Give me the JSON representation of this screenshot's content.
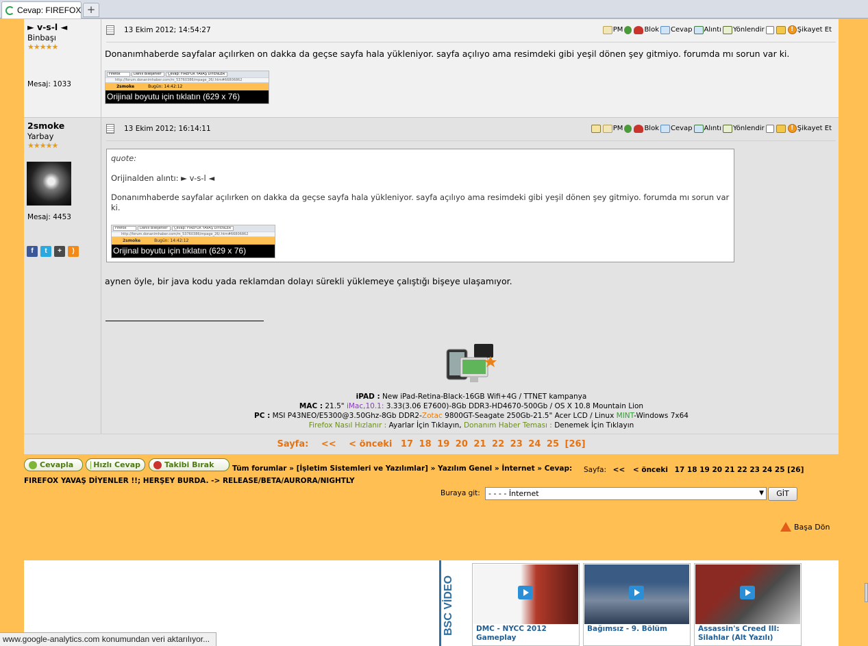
{
  "tab": {
    "title": "Cevap: FIREFOX...",
    "new_tab": "+"
  },
  "posts": [
    {
      "username": "► v-s-l ◄",
      "rank": "Binbaşı",
      "stars": "★★★★★",
      "message_count": "Mesaj: 1033",
      "date": "13 Ekim 2012; 14:54:27",
      "body": "Donanımhaberde sayfalar açılırken on dakka da geçse sayfa hala yükleniyor. sayfa açılıyo ama resimdeki gibi yeşil dönen şey gitmiyo. forumda mı sorun var ki.",
      "thumb_caption": "Orijinal boyutu için tıklatın (629 x 76)"
    },
    {
      "username": "2smoke",
      "rank": "Yarbay",
      "stars": "★★★★★",
      "message_count": "Mesaj: 4453",
      "date": "13 Ekim 2012; 16:14:11",
      "quote_label": "quote:",
      "quote_source": "Orijinalden alıntı: ► v-s-l ◄",
      "quote_body": "Donanımhaberde sayfalar açılırken on dakka da geçse sayfa hala yükleniyor. sayfa açılıyo ama resimdeki gibi yeşil dönen şey gitmiyo. forumda mı sorun var ki.",
      "thumb_caption": "Orijinal boyutu için tıklatın (629 x 76)",
      "body": "aynen öyle, bir java kodu yada reklamdan dolayı sürekli yüklemeye çalıştığı bişeye ulaşamıyor.",
      "signature": {
        "ipad_label": "iPAD :",
        "ipad_text": "New iPad-Retina-Black-16GB Wifi+4G / TTNET kampanya",
        "mac_label": "MAC :",
        "mac_a": "21.5\"",
        "mac_b": "iMac,10.1:",
        "mac_c": "3.33(3.06 E7600)-8Gb DDR3-HD4670-500Gb / OS X 10.8 Mountain Lion",
        "pc_label": "PC :",
        "pc_a": "MSI P43NEO/E5300@3.50Ghz-8Gb DDR2-",
        "pc_b": "Zotac",
        "pc_c": "9800GT-Seagate 250Gb-21.5\" Acer LCD / Linux",
        "pc_d": "MINT",
        "pc_e": "-Windows 7x64",
        "ff_a": "Firefox Nasıl Hızlanır :",
        "ff_b": "Ayarlar İçin Tıklayın,",
        "ff_c": "Donanım Haber Teması :",
        "ff_d": "Denemek İçin Tıklayın"
      }
    }
  ],
  "actions": {
    "pm": "PM",
    "blok": "Blok",
    "cevap": "Cevap",
    "alinti": "Alıntı",
    "yonlendir": "Yönlendir",
    "sikayet": "Şikayet Et"
  },
  "thumb_tabs": {
    "t1": "Firefox",
    "t2": "Dahili Bileşenler",
    "t3": "Cevap: FIREFOX YAVAŞ DİYENLER !!;",
    "url": "http://forum.donanimhaber.com/m_53760386/mpage_26/.htm#66806862",
    "user": "2smoke",
    "time": "Bugün: 14:42:12"
  },
  "pagination": {
    "label": "Sayfa:",
    "first": "<<",
    "prev": "< önceki",
    "pages": [
      "17",
      "18",
      "19",
      "20",
      "21",
      "22",
      "23",
      "24",
      "25",
      "[26]"
    ]
  },
  "toolbar": {
    "cevapla": "Cevapla",
    "hizli_cevap": "Hızlı Cevap",
    "takibi_birak": "Takibi Bırak"
  },
  "breadcrumb": {
    "line1": "Tüm forumlar » [İşletim Sistemleri ve Yazılımlar] » Yazılım Genel » İnternet » Cevap:",
    "line2": "FIREFOX YAVAŞ DİYENLER !!; HERŞEY BURDA. -> RELEASE/BETA/AURORA/NIGHTLY"
  },
  "goto": {
    "label": "Buraya git:",
    "selected": "- - - - İnternet",
    "button": "GİT"
  },
  "back_to_top": "Başa Dön",
  "video": {
    "section_label": "BSC VİDEO",
    "items": [
      {
        "title_1": "DMC - NYCC 2012",
        "title_2": "Gameplay"
      },
      {
        "title_1": "Bağımsız - 9. Bölüm",
        "title_2": ""
      },
      {
        "title_1": "Assassin's Creed III:",
        "title_2": "Silahlar (Alt Yazılı)"
      }
    ]
  },
  "status_bar": "www.google-analytics.com konumundan veri aktarılıyor..."
}
